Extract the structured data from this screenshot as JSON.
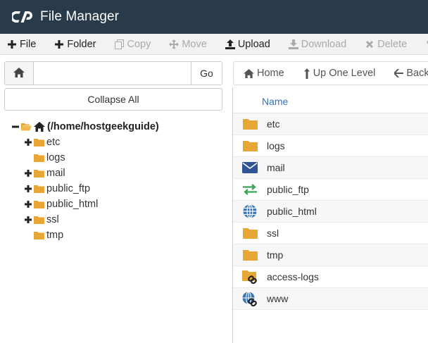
{
  "app": {
    "title": "File Manager"
  },
  "toolbar": {
    "file": "File",
    "folder": "Folder",
    "copy": "Copy",
    "move": "Move",
    "upload": "Upload",
    "download": "Download",
    "delete": "Delete"
  },
  "sidebar": {
    "path_value": "",
    "path_placeholder": "",
    "go_label": "Go",
    "collapse_label": "Collapse All",
    "root_label": "(/home/hostgeekguide)",
    "tree_items": [
      {
        "label": "etc",
        "expandable": true
      },
      {
        "label": "logs",
        "expandable": false
      },
      {
        "label": "mail",
        "expandable": true
      },
      {
        "label": "public_ftp",
        "expandable": true
      },
      {
        "label": "public_html",
        "expandable": true
      },
      {
        "label": "ssl",
        "expandable": true
      },
      {
        "label": "tmp",
        "expandable": false
      }
    ]
  },
  "nav": {
    "home": "Home",
    "up": "Up One Level",
    "back": "Back"
  },
  "filelist": {
    "name_header": "Name",
    "rows": [
      {
        "name": "etc",
        "icon": "folder-icon"
      },
      {
        "name": "logs",
        "icon": "folder-icon"
      },
      {
        "name": "mail",
        "icon": "mail-icon"
      },
      {
        "name": "public_ftp",
        "icon": "ftp-transfer-icon"
      },
      {
        "name": "public_html",
        "icon": "globe-icon"
      },
      {
        "name": "ssl",
        "icon": "folder-icon"
      },
      {
        "name": "tmp",
        "icon": "folder-icon"
      },
      {
        "name": "access-logs",
        "icon": "folder-link-icon"
      },
      {
        "name": "www",
        "icon": "globe-link-icon"
      }
    ]
  },
  "colors": {
    "titlebar": "#293a4a",
    "folder": "#e8a735",
    "link": "#3373b8",
    "ftp": "#3aa55a",
    "mail": "#2f5597"
  }
}
